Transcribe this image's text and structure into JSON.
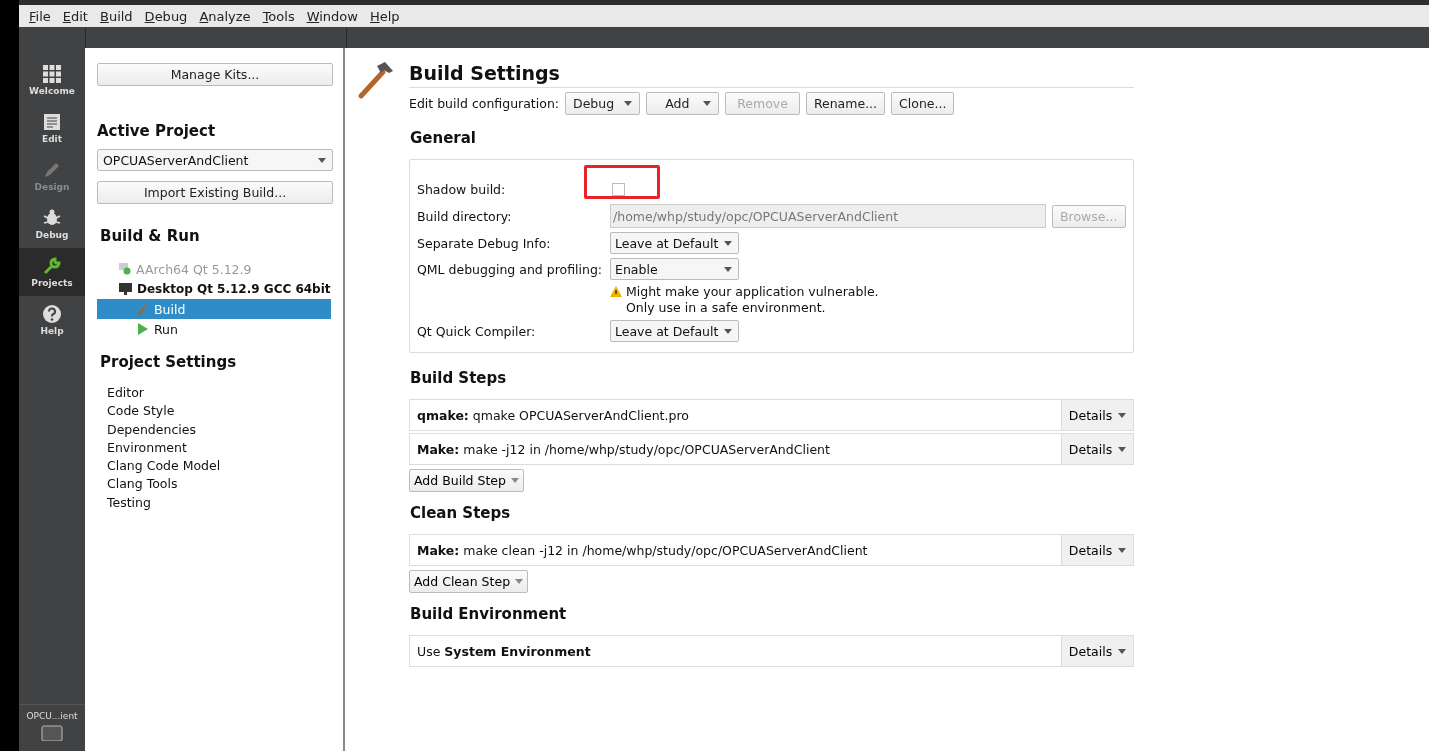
{
  "menu": [
    "File",
    "Edit",
    "Build",
    "Debug",
    "Analyze",
    "Tools",
    "Window",
    "Help"
  ],
  "modes": [
    {
      "label": "Welcome",
      "selected": false,
      "disabled": false
    },
    {
      "label": "Edit",
      "selected": false,
      "disabled": false
    },
    {
      "label": "Design",
      "selected": false,
      "disabled": true
    },
    {
      "label": "Debug",
      "selected": false,
      "disabled": false
    },
    {
      "label": "Projects",
      "selected": true,
      "disabled": false
    },
    {
      "label": "Help",
      "selected": false,
      "disabled": false
    }
  ],
  "project_selector": {
    "label": "OPCU...ient"
  },
  "left_panel": {
    "manage_kits": "Manage Kits...",
    "active_project_heading": "Active Project",
    "project": "OPCUAServerAndClient",
    "import_button": "Import Existing Build...",
    "build_run_heading": "Build & Run",
    "kits": [
      {
        "label": "AArch64 Qt 5.12.9",
        "disabled": true,
        "expanded": false
      },
      {
        "label": "Desktop Qt 5.12.9 GCC 64bit",
        "disabled": false,
        "expanded": true,
        "children": [
          {
            "label": "Build",
            "kind": "build",
            "selected": true
          },
          {
            "label": "Run",
            "kind": "run",
            "selected": false
          }
        ]
      }
    ],
    "settings_heading": "Project Settings",
    "settings": [
      "Editor",
      "Code Style",
      "Dependencies",
      "Environment",
      "Clang Code Model",
      "Clang Tools",
      "Testing"
    ]
  },
  "main": {
    "title": "Build Settings",
    "config_label": "Edit build configuration:",
    "config_controls": [
      {
        "label": "Debug",
        "kind": "combo",
        "disabled": false
      },
      {
        "label": "Add",
        "kind": "menu",
        "disabled": false
      },
      {
        "label": "Remove",
        "kind": "button",
        "disabled": true
      },
      {
        "label": "Rename...",
        "kind": "button",
        "disabled": false
      },
      {
        "label": "Clone...",
        "kind": "button",
        "disabled": false
      }
    ],
    "general_heading": "General",
    "general": [
      {
        "label": "Shadow build:",
        "kind": "checkbox",
        "checked": false,
        "highlighted": true
      },
      {
        "label": "Build directory:",
        "kind": "path",
        "value": "/home/whp/study/opc/OPCUAServerAndClient",
        "disabled": true,
        "button": "Browse..."
      },
      {
        "label": "Separate Debug Info:",
        "kind": "combo",
        "value": "Leave at Default"
      },
      {
        "label": "QML debugging and profiling:",
        "kind": "combo",
        "value": "Enable",
        "warning": [
          "Might make your application vulnerable.",
          "Only use in a safe environment."
        ]
      },
      {
        "label": "Qt Quick Compiler:",
        "kind": "combo",
        "value": "Leave at Default"
      }
    ],
    "sections": [
      {
        "heading": "Build Steps",
        "steps": [
          "**qmake:** qmake OPCUAServerAndClient.pro",
          "**Make:** make -j12 in /home/whp/study/opc/OPCUAServerAndClient"
        ],
        "details": [
          "Details",
          "Details"
        ],
        "add_button": "Add Build Step"
      },
      {
        "heading": "Clean Steps",
        "steps": [
          "**Make:** make clean -j12 in /home/whp/study/opc/OPCUAServerAndClient"
        ],
        "details": [
          "Details"
        ],
        "add_button": "Add Clean Step"
      },
      {
        "heading": "Build Environment",
        "steps": [
          "Use **System Environment**"
        ],
        "details": [
          "Details"
        ]
      }
    ]
  }
}
